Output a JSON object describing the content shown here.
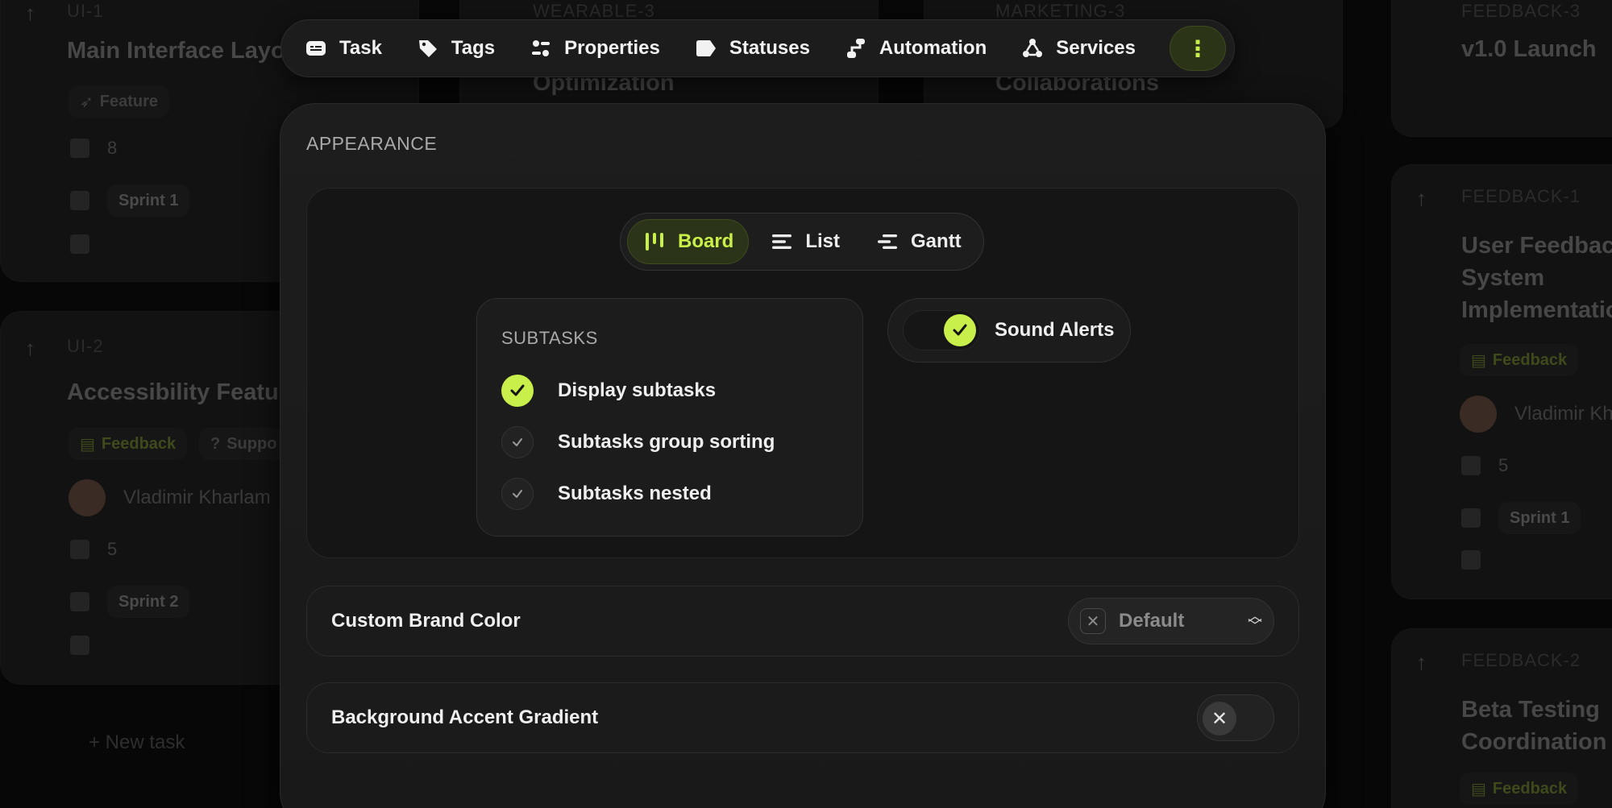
{
  "background": {
    "cards": [
      {
        "key": "UI-1",
        "title": "Main Interface Layo",
        "chip": "Feature",
        "count": "8",
        "sprint": "Sprint 1"
      },
      {
        "key": "UI-2",
        "title": "Accessibility Featur",
        "chips": [
          "Feedback",
          "Suppo"
        ],
        "assignee": "Vladimir Kharlam",
        "count": "5",
        "sprint": "Sprint 2"
      },
      {
        "key": "WEARABLE-3",
        "title": "Optimization"
      },
      {
        "key": "MARKETING-3",
        "title": "Collaborations"
      },
      {
        "key": "FEEDBACK-3",
        "title": "v1.0 Launch"
      },
      {
        "key": "FEEDBACK-1",
        "title_lines": [
          "User Feedbac",
          "System",
          "Implementatio"
        ],
        "chip": "Feedback",
        "assignee": "Vladimir Kh",
        "count": "5",
        "sprint": "Sprint 1"
      },
      {
        "key": "FEEDBACK-2",
        "title_lines": [
          "Beta Testing",
          "Coordination"
        ],
        "chip": "Feedback"
      }
    ],
    "new_task": "+ New task"
  },
  "topnav": {
    "items": [
      {
        "label": "Task",
        "icon": "task-icon"
      },
      {
        "label": "Tags",
        "icon": "tag-icon"
      },
      {
        "label": "Properties",
        "icon": "properties-icon"
      },
      {
        "label": "Statuses",
        "icon": "status-icon"
      },
      {
        "label": "Automation",
        "icon": "automation-icon"
      },
      {
        "label": "Services",
        "icon": "services-icon"
      }
    ],
    "more": "⋮"
  },
  "modal": {
    "section_title": "APPEARANCE",
    "views": [
      {
        "label": "Board",
        "icon": "board-icon",
        "active": true
      },
      {
        "label": "List",
        "icon": "list-icon",
        "active": false
      },
      {
        "label": "Gantt",
        "icon": "gantt-icon",
        "active": false
      }
    ],
    "subtasks": {
      "title": "SUBTASKS",
      "options": [
        {
          "label": "Display subtasks",
          "checked": true
        },
        {
          "label": "Subtasks group sorting",
          "checked": false
        },
        {
          "label": "Subtasks nested",
          "checked": false
        }
      ]
    },
    "sound_alerts": {
      "label": "Sound Alerts",
      "on": true
    },
    "brand_color": {
      "label": "Custom Brand Color",
      "value": "Default"
    },
    "gradient": {
      "label": "Background Accent Gradient",
      "on": false
    }
  },
  "colors": {
    "accent": "#c9f04a",
    "accent_bg": "#2b3418",
    "modal_bg": "#1c1c1c"
  }
}
